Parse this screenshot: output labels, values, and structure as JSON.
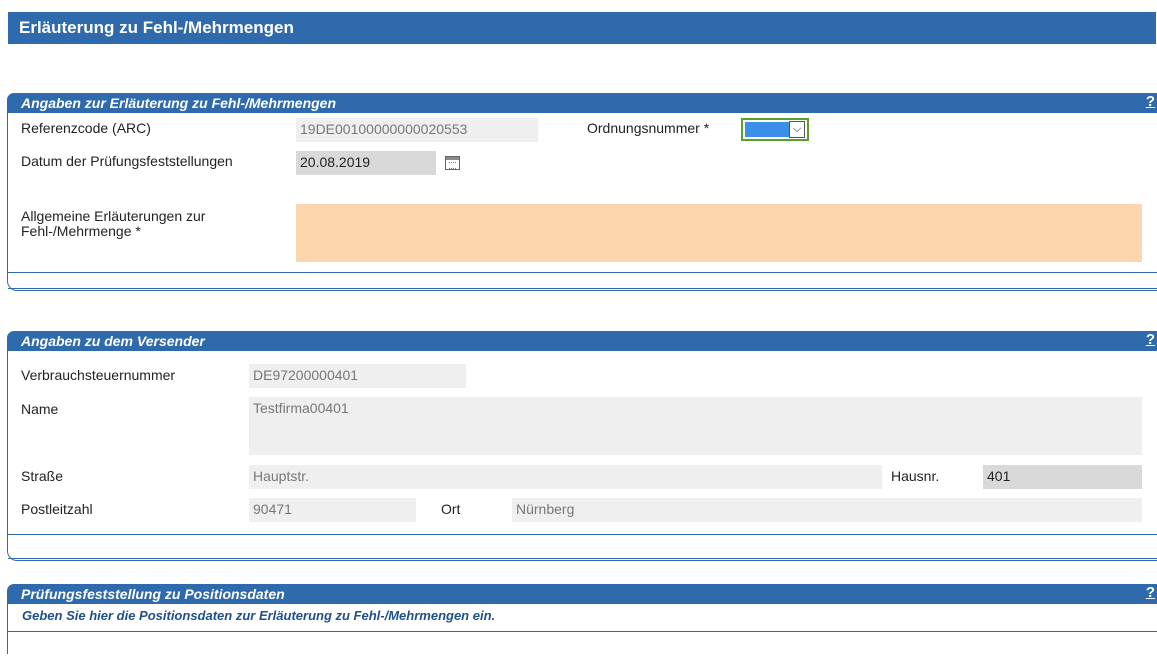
{
  "page": {
    "title": "Erläuterung zu Fehl-/Mehrmengen"
  },
  "panel1": {
    "title": "Angaben zur Erläuterung zu Fehl-/Mehrmengen",
    "help": "?",
    "arc_label": "Referenzcode (ARC)",
    "arc_value": "19DE00100000000020553",
    "ordnungsnummer_label": "Ordnungsnummer *",
    "ordnungsnummer_value": "",
    "datum_label": "Datum der Prüfungsfeststellungen",
    "datum_value": "20.08.2019",
    "erlaeuterung_label_1": "Allgemeine Erläuterungen zur",
    "erlaeuterung_label_2": "Fehl-/Mehrmenge *",
    "erlaeuterung_value": ""
  },
  "panel2": {
    "title": "Angaben zu dem Versender",
    "help": "?",
    "vst_label": "Verbrauchsteuernummer",
    "vst_value": "DE97200000401",
    "name_label": "Name",
    "name_value": "Testfirma00401",
    "strasse_label": "Straße",
    "strasse_value": "Hauptstr.",
    "hausnr_label": "Hausnr.",
    "hausnr_value": "401",
    "plz_label": "Postleitzahl",
    "plz_value": "90471",
    "ort_label": "Ort",
    "ort_value": "Nürnberg"
  },
  "panel3": {
    "title": "Prüfungsfeststellung zu Positionsdaten",
    "help": "?",
    "info": "Geben Sie hier die Positionsdaten zur Erläuterung zu Fehl-/Mehrmengen ein."
  },
  "colors": {
    "header_blue": "#2f6aac",
    "required_fill": "#fcd6ac",
    "focus_green": "#5aa02c"
  }
}
